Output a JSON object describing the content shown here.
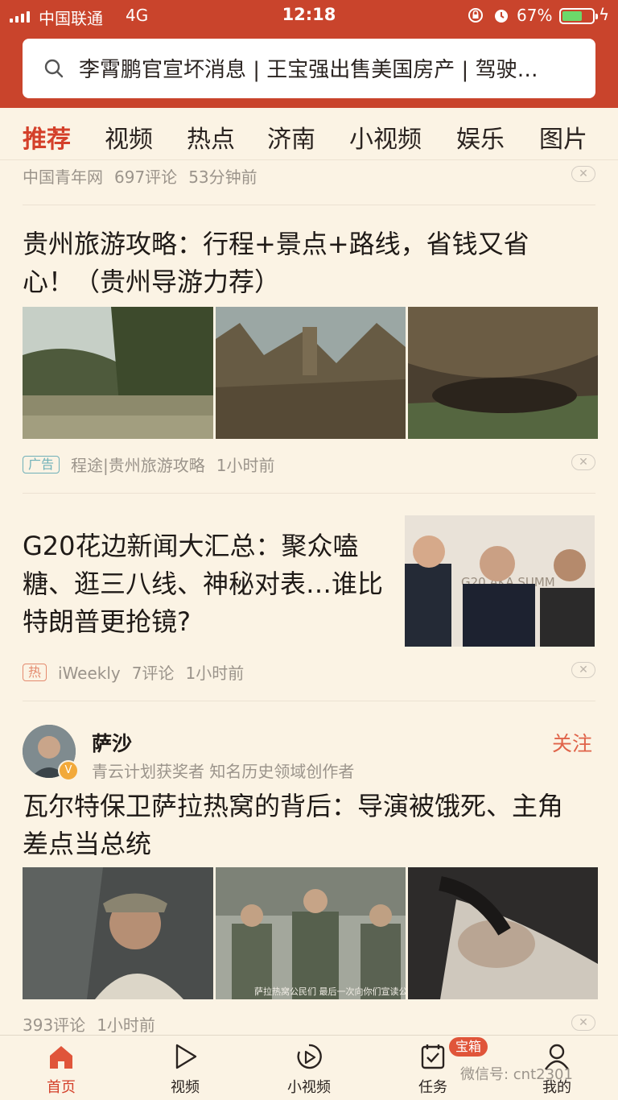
{
  "status_bar": {
    "carrier": "中国联通",
    "network": "4G",
    "time": "12:18",
    "battery_pct": "67%",
    "battery_level": 0.67
  },
  "search": {
    "text": "李霄鹏官宣坏消息 | 王宝强出售美国房产 | 驾驶…"
  },
  "tabs": [
    "推荐",
    "视频",
    "热点",
    "济南",
    "小视频",
    "娱乐",
    "图片"
  ],
  "feed": {
    "item0": {
      "source": "中国青年网",
      "comments": "697评论",
      "time": "53分钟前"
    },
    "item1": {
      "title": "贵州旅游攻略：行程+景点+路线，省钱又省心！（贵州导游力荐）",
      "tag": "广告",
      "source": "程途|贵州旅游攻略",
      "time": "1小时前"
    },
    "item2": {
      "title": "G20花边新闻大汇总：聚众嗑糖、逛三八线、神秘对表…谁比特朗普更抢镜?",
      "tag": "热",
      "source": "iWeekly",
      "comments": "7评论",
      "time": "1小时前",
      "image_caption": "G20 AKA SUMM"
    },
    "item3": {
      "author": "萨沙",
      "author_desc": "青云计划获奖者 知名历史领域创作者",
      "verified_badge": "V",
      "follow": "关注",
      "title": "瓦尔特保卫萨拉热窝的背后：导演被饿死、主角差点当总统",
      "image_caption": "萨拉热窝公民们 最后一次向你们宣读公告",
      "comments": "393评论",
      "time": "1小时前"
    },
    "dislike_glyph": "✕"
  },
  "bottom_nav": [
    {
      "label": "首页",
      "icon": "home-icon",
      "active": true
    },
    {
      "label": "视频",
      "icon": "play-icon"
    },
    {
      "label": "小视频",
      "icon": "short-video-icon"
    },
    {
      "label": "任务",
      "icon": "task-icon"
    },
    {
      "label": "我的",
      "icon": "profile-icon"
    }
  ],
  "task_badge": "宝箱",
  "watermark": "微信号: cnt2301",
  "colors": {
    "brand_red": "#c9442c",
    "active_red": "#d4402a",
    "background": "#fbf3e4"
  }
}
